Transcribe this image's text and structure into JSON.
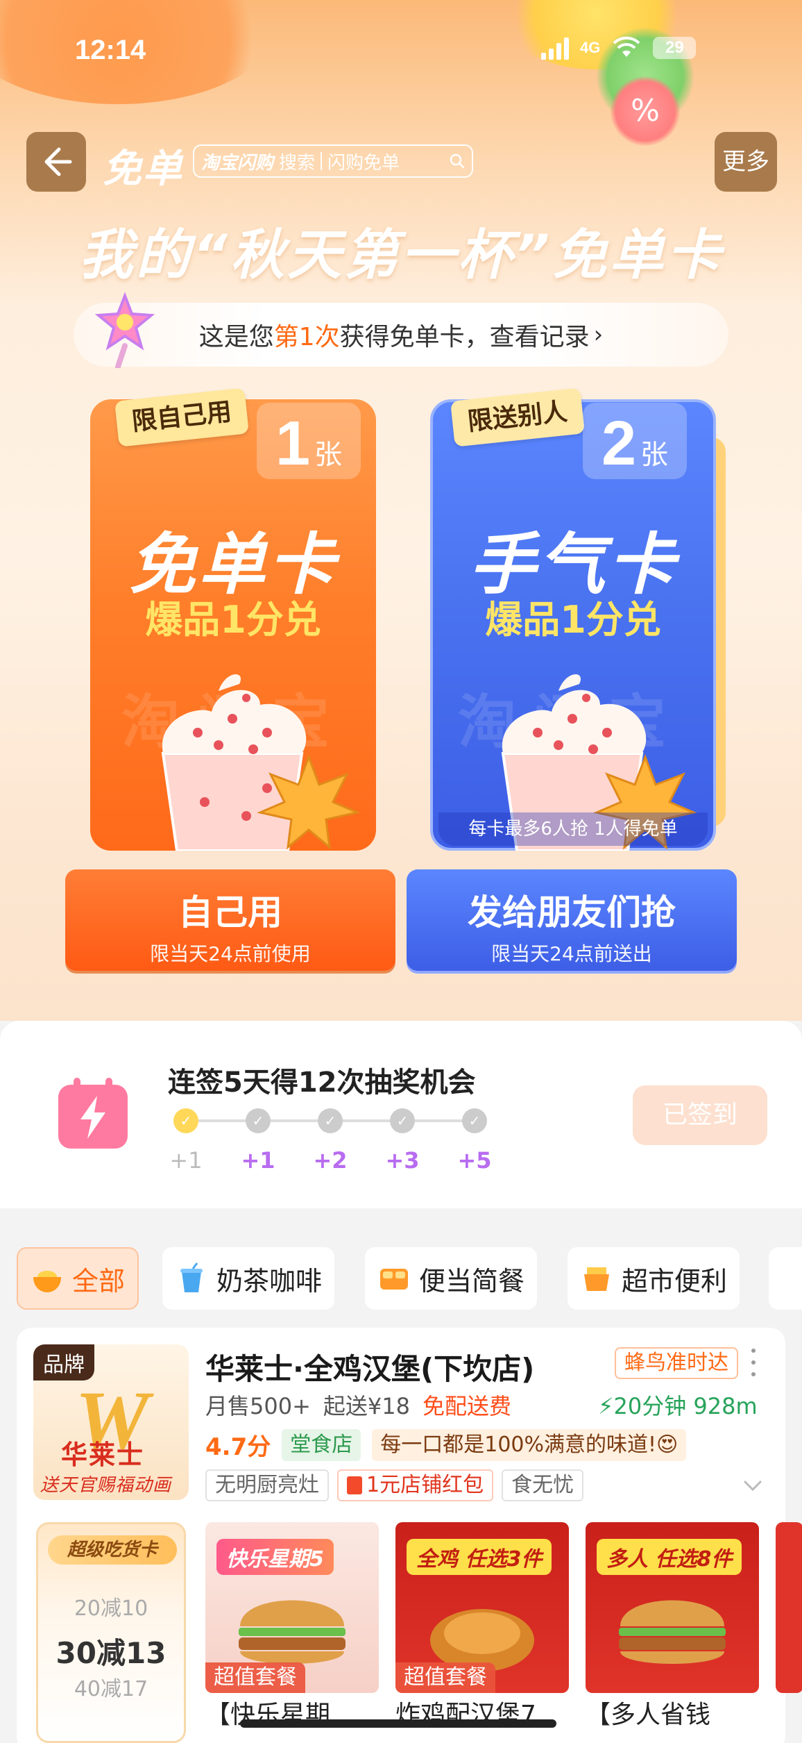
{
  "status_bar": {
    "time": "12:14",
    "network": "4G",
    "battery": "29"
  },
  "nav": {
    "back_icon": "back-arrow-icon",
    "title": "免单",
    "search_brand": "淘宝闪购",
    "search_label": "搜索",
    "search_placeholder": "闪购免单",
    "more_label": "更多"
  },
  "headline": "我的“秋天第一杯”免单卡",
  "record": {
    "prefix": "这是您",
    "highlight": "第1次",
    "suffix": "获得免单卡，查看记录",
    "arrow": "›"
  },
  "cards": [
    {
      "tag": "限自己用",
      "count": "1",
      "unit": "张",
      "title": "免单卡",
      "subtitle": "爆品1分兑",
      "watermark": "淘闪宝"
    },
    {
      "tag": "限送别人",
      "count": "2",
      "unit": "张",
      "title": "手气卡",
      "subtitle": "爆品1分兑",
      "watermark": "淘闪宝",
      "note": "每卡最多6人抢 1人得免单"
    }
  ],
  "actions": {
    "self": {
      "label": "自己用",
      "sub": "限当天24点前使用"
    },
    "send": {
      "label": "发给朋友们抢",
      "sub": "限当天24点前送出"
    }
  },
  "checkin": {
    "title": "连签5天得12次抽奖机会",
    "steps": [
      "+1",
      "+1",
      "+2",
      "+3",
      "+5"
    ],
    "completed_steps": 1,
    "button_label": "已签到"
  },
  "categories": [
    {
      "label": "全部",
      "icon": "bowl-icon",
      "active": true
    },
    {
      "label": "奶茶咖啡",
      "icon": "drink-cup-icon",
      "active": false
    },
    {
      "label": "便当简餐",
      "icon": "bento-icon",
      "active": false
    },
    {
      "label": "超市便利",
      "icon": "store-basket-icon",
      "active": false
    }
  ],
  "store": {
    "brand_badge": "品牌",
    "logo_name": "华莱士",
    "logo_slogan": "送天官赐福动画周边",
    "name": "华莱士·全鸡汉堡(下坎店)",
    "rider_tag": "蜂鸟准时达",
    "monthly_sales": "月售500+",
    "min_order": "起送¥18",
    "delivery_fee": "免配送费",
    "eta": "20分钟 928m",
    "rating": "4.7分",
    "dine_tag": "堂食店",
    "quote": "每一口都是100%满意的味道!😍",
    "tags": [
      "无明厨亮灶",
      "1元店铺红包",
      "食无忧"
    ]
  },
  "coupon": {
    "header": "超级吃货卡",
    "line1": "20减10",
    "line2": "30减13",
    "line3": "40减17"
  },
  "products": [
    {
      "banner": "快乐星期5",
      "badge": "超值套餐",
      "name": "【快乐星期"
    },
    {
      "banner": "全鸡 任选3件",
      "badge": "超值套餐",
      "name": "炸鸡配汉堡7"
    },
    {
      "banner": "多人 任选8件",
      "badge": "",
      "name": "【多人省钱"
    }
  ],
  "colors": {
    "accent_orange": "#ff6a14",
    "accent_blue": "#4a73f0",
    "eta_green": "#27a35a"
  }
}
